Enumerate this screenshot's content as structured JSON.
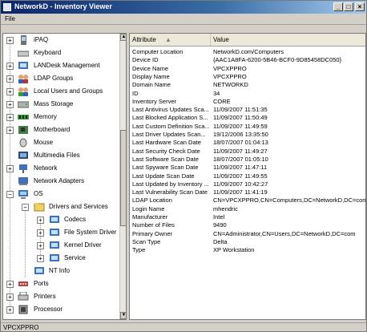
{
  "window": {
    "title": "NetworkD - Inventory Viewer",
    "minimize": "_",
    "maximize": "□",
    "close": "×"
  },
  "menu": {
    "file": "File"
  },
  "tree": {
    "expanders": {
      "collapsed": "+",
      "expanded": "−"
    },
    "items": [
      {
        "label": "iPAQ",
        "icon": "pda-icon"
      },
      {
        "label": "Keyboard",
        "icon": "keyboard-icon"
      },
      {
        "label": "LANDesk Management",
        "icon": "management-icon"
      },
      {
        "label": "LDAP Groups",
        "icon": "group-icon"
      },
      {
        "label": "Local Users and Groups",
        "icon": "users-icon"
      },
      {
        "label": "Mass Storage",
        "icon": "storage-icon"
      },
      {
        "label": "Memory",
        "icon": "memory-icon"
      },
      {
        "label": "Motherboard",
        "icon": "motherboard-icon"
      },
      {
        "label": "Mouse",
        "icon": "mouse-icon"
      },
      {
        "label": "Multimedia Files",
        "icon": "multimedia-icon"
      },
      {
        "label": "Network",
        "icon": "network-icon"
      },
      {
        "label": "Network Adapters",
        "icon": "adapter-icon"
      },
      {
        "label": "OS",
        "icon": "os-icon"
      },
      {
        "label": "Drivers and Services",
        "icon": "folder-icon"
      },
      {
        "label": "Codecs",
        "icon": "codec-icon"
      },
      {
        "label": "File System Driver",
        "icon": "driver-icon"
      },
      {
        "label": "Kernel Driver",
        "icon": "driver-icon"
      },
      {
        "label": "Service",
        "icon": "service-icon"
      },
      {
        "label": "NT Info",
        "icon": "info-icon"
      },
      {
        "label": "Ports",
        "icon": "ports-icon"
      },
      {
        "label": "Printers",
        "icon": "printer-icon"
      },
      {
        "label": "Processor",
        "icon": "processor-icon"
      }
    ]
  },
  "grid": {
    "headers": {
      "attribute": "Attribute",
      "value": "Value"
    },
    "rows": [
      {
        "attribute": "Computer Location",
        "value": "NetworkD.com/Computers"
      },
      {
        "attribute": "Device ID",
        "value": "{AAC1A8FA-6200-5B46-BCF0-9D85458DC050}"
      },
      {
        "attribute": "Device Name",
        "value": "VPCXPPRO"
      },
      {
        "attribute": "Display Name",
        "value": "VPCXPPRO"
      },
      {
        "attribute": "Domain Name",
        "value": "NETWORKD"
      },
      {
        "attribute": "ID",
        "value": "34"
      },
      {
        "attribute": "Inventory Server",
        "value": "CORE"
      },
      {
        "attribute": "Last Antivirus Updates Sca...",
        "value": "11/09/2007 11:51:35"
      },
      {
        "attribute": "Last Blocked Application S...",
        "value": "11/09/2007 11:50:49"
      },
      {
        "attribute": "Last Custom Definition Sca...",
        "value": "11/09/2007 11:49:59"
      },
      {
        "attribute": "Last Driver Updates Scan...",
        "value": "19/12/2006 13:35:50"
      },
      {
        "attribute": "Last Hardware Scan Date",
        "value": "18/07/2007 01:04:13"
      },
      {
        "attribute": "Last Security Check Date",
        "value": "11/09/2007 11:49:27"
      },
      {
        "attribute": "Last Software Scan Date",
        "value": "18/07/2007 01:05:10"
      },
      {
        "attribute": "Last Spyware Scan Date",
        "value": "11/09/2007 11:47:11"
      },
      {
        "attribute": "Last Update Scan Date",
        "value": "11/09/2007 11:49:55"
      },
      {
        "attribute": "Last Updated by Inventory ...",
        "value": "11/09/2007 10:42:27"
      },
      {
        "attribute": "Last Vulnerability Scan Date",
        "value": "11/09/2007 11:41:19"
      },
      {
        "attribute": "LDAP Location",
        "value": "CN=VPCXPPRO,CN=Computers,DC=NetworkD,DC=com"
      },
      {
        "attribute": "Login Name",
        "value": "mhendric"
      },
      {
        "attribute": "Manufacturer",
        "value": "Intel"
      },
      {
        "attribute": "Number of Files",
        "value": "9490"
      },
      {
        "attribute": "Primary Owner",
        "value": "CN=Administrator,CN=Users,DC=NetworkD,DC=com"
      },
      {
        "attribute": "Scan Type",
        "value": "Delta"
      },
      {
        "attribute": "Type",
        "value": "XP Workstation"
      }
    ]
  },
  "status": {
    "text": "VPCXPPRO"
  }
}
